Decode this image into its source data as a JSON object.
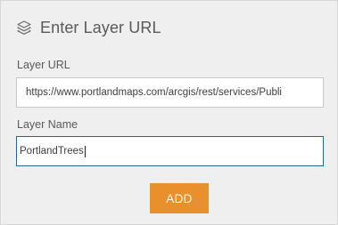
{
  "header": {
    "title": "Enter Layer URL",
    "icon": "layers-icon"
  },
  "layer_url": {
    "label": "Layer URL",
    "value": "https://www.portlandmaps.com/arcgis/rest/services/Publi"
  },
  "layer_name": {
    "label": "Layer Name",
    "value": "PortlandTrees"
  },
  "add_button": {
    "label": "ADD",
    "color": "#e8902c"
  }
}
